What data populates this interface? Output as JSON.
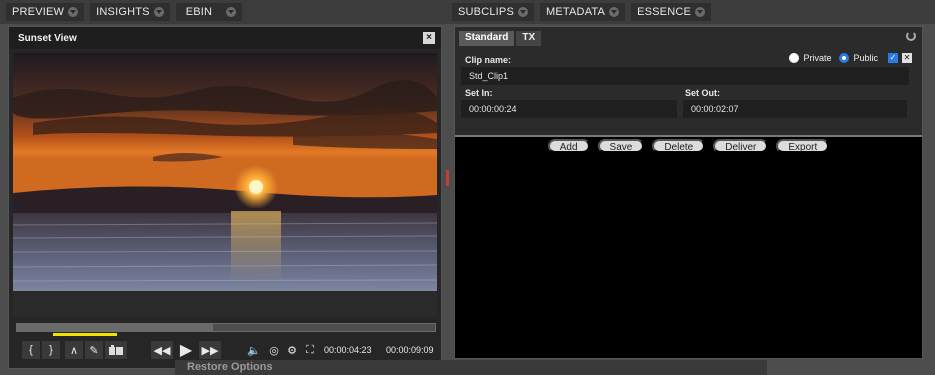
{
  "tabs_left": [
    {
      "label": "PREVIEW"
    },
    {
      "label": "INSIGHTS"
    },
    {
      "label": "EBIN"
    }
  ],
  "tabs_right": [
    {
      "label": "SUBCLIPS"
    },
    {
      "label": "METADATA"
    },
    {
      "label": "ESSENCE"
    }
  ],
  "viewer": {
    "title": "Sunset View",
    "close_glyph": "×",
    "progress_fraction": 0.47,
    "current_time": "00:00:04:23",
    "duration": "00:00:09:09",
    "controls": {
      "mark_in": "{",
      "mark_out": "}",
      "prev_marker": "∧",
      "edit": "✎",
      "rewind": "◀◀",
      "play": "▶",
      "fast_forward": "▶▶",
      "volume": "🔈",
      "snapshot": "◎",
      "settings": "⚙",
      "fullscreen": "⛶"
    }
  },
  "subclips": {
    "tabs": [
      {
        "label": "Standard"
      },
      {
        "label": "TX"
      }
    ],
    "clip_name_label": "Clip name:",
    "clip_name_value": "Std_Clip1",
    "visibility": {
      "private_label": "Private",
      "public_label": "Public",
      "selected": "Public"
    },
    "set_in_label": "Set In:",
    "set_in_value": "00:00:00:24",
    "set_out_label": "Set Out:",
    "set_out_value": "00:00:02:07",
    "actions": [
      {
        "label": "Add"
      },
      {
        "label": "Save"
      },
      {
        "label": "Delete"
      },
      {
        "label": "Deliver"
      },
      {
        "label": "Export"
      }
    ]
  },
  "footer": {
    "label": "Restore Options"
  },
  "colors": {
    "accent": "#2a7be4",
    "marker": "#f2e300",
    "splitter": "#c43c3c"
  }
}
